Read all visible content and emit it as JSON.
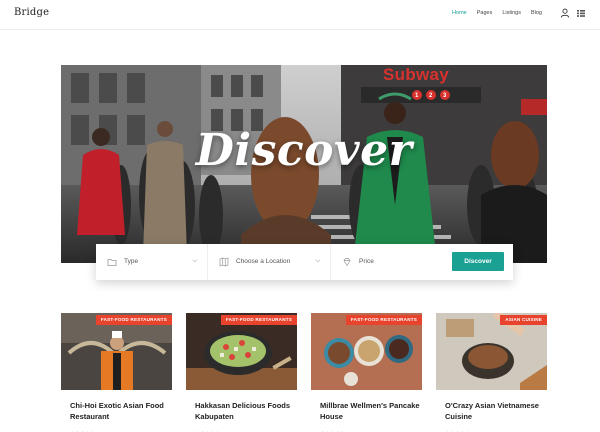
{
  "header": {
    "brand": "Bridge",
    "nav": [
      {
        "label": "Home",
        "active": true
      },
      {
        "label": "Pages",
        "active": false
      },
      {
        "label": "Listings",
        "active": false
      },
      {
        "label": "Blog",
        "active": false
      }
    ],
    "icons": [
      "user-icon",
      "grid-icon"
    ]
  },
  "hero": {
    "title": "Discover",
    "sign_text": "Subway"
  },
  "search": {
    "type_label": "Type",
    "location_label": "Choose a Location",
    "price_label": "Price",
    "button_label": "Discover",
    "accent_color": "#1aa193"
  },
  "cards": [
    {
      "tag": "FAST-FOOD RESTAURANTS",
      "title": "Chi-Hoi Exotic Asian Food Restaurant",
      "stars": "★★★★★"
    },
    {
      "tag": "FAST-FOOD RESTAURANTS",
      "title": "Hakkasan Delicious Foods Kabupaten",
      "stars": "★★★★★"
    },
    {
      "tag": "FAST-FOOD RESTAURANTS",
      "title": "Millbrae Wellmen's Pancake House",
      "stars": "★★★★★"
    },
    {
      "tag": "ASIAN CUISINE",
      "title": "O'Crazy Asian Vietnamese Cuisine",
      "stars": "★★★★★"
    }
  ],
  "colors": {
    "tag": "#e8432d",
    "accent": "#1aa193"
  }
}
